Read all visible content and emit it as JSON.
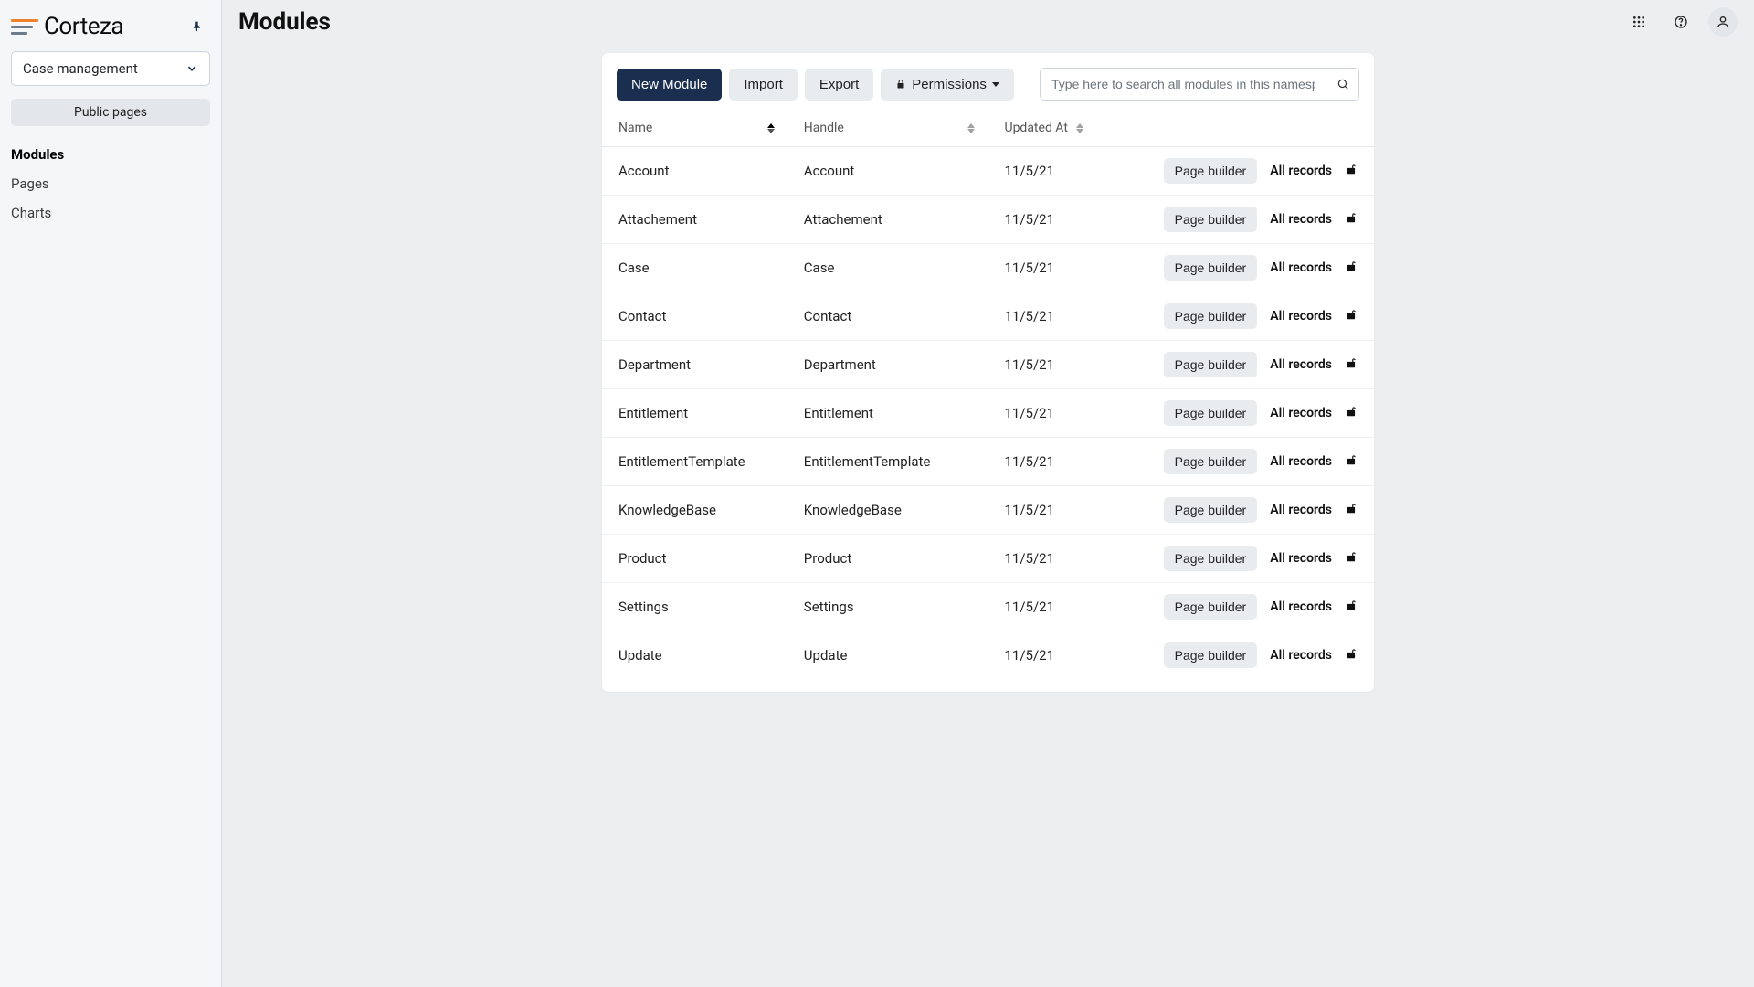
{
  "app_name": "Corteza",
  "page_title": "Modules",
  "namespace_selected": "Case management",
  "sidebar": {
    "public_pages_label": "Public pages",
    "items": [
      {
        "label": "Modules",
        "active": true
      },
      {
        "label": "Pages",
        "active": false
      },
      {
        "label": "Charts",
        "active": false
      }
    ]
  },
  "toolbar": {
    "new_module_label": "New Module",
    "import_label": "Import",
    "export_label": "Export",
    "permissions_label": "Permissions"
  },
  "search": {
    "placeholder": "Type here to search all modules in this namespace"
  },
  "table": {
    "columns": {
      "name": "Name",
      "handle": "Handle",
      "updated_at": "Updated At"
    },
    "page_builder_label": "Page builder",
    "all_records_label": "All records",
    "rows": [
      {
        "name": "Account",
        "handle": "Account",
        "updated_at": "11/5/21"
      },
      {
        "name": "Attachement",
        "handle": "Attachement",
        "updated_at": "11/5/21"
      },
      {
        "name": "Case",
        "handle": "Case",
        "updated_at": "11/5/21"
      },
      {
        "name": "Contact",
        "handle": "Contact",
        "updated_at": "11/5/21"
      },
      {
        "name": "Department",
        "handle": "Department",
        "updated_at": "11/5/21"
      },
      {
        "name": "Entitlement",
        "handle": "Entitlement",
        "updated_at": "11/5/21"
      },
      {
        "name": "EntitlementTemplate",
        "handle": "EntitlementTemplate",
        "updated_at": "11/5/21"
      },
      {
        "name": "KnowledgeBase",
        "handle": "KnowledgeBase",
        "updated_at": "11/5/21"
      },
      {
        "name": "Product",
        "handle": "Product",
        "updated_at": "11/5/21"
      },
      {
        "name": "Settings",
        "handle": "Settings",
        "updated_at": "11/5/21"
      },
      {
        "name": "Update",
        "handle": "Update",
        "updated_at": "11/5/21"
      }
    ]
  }
}
